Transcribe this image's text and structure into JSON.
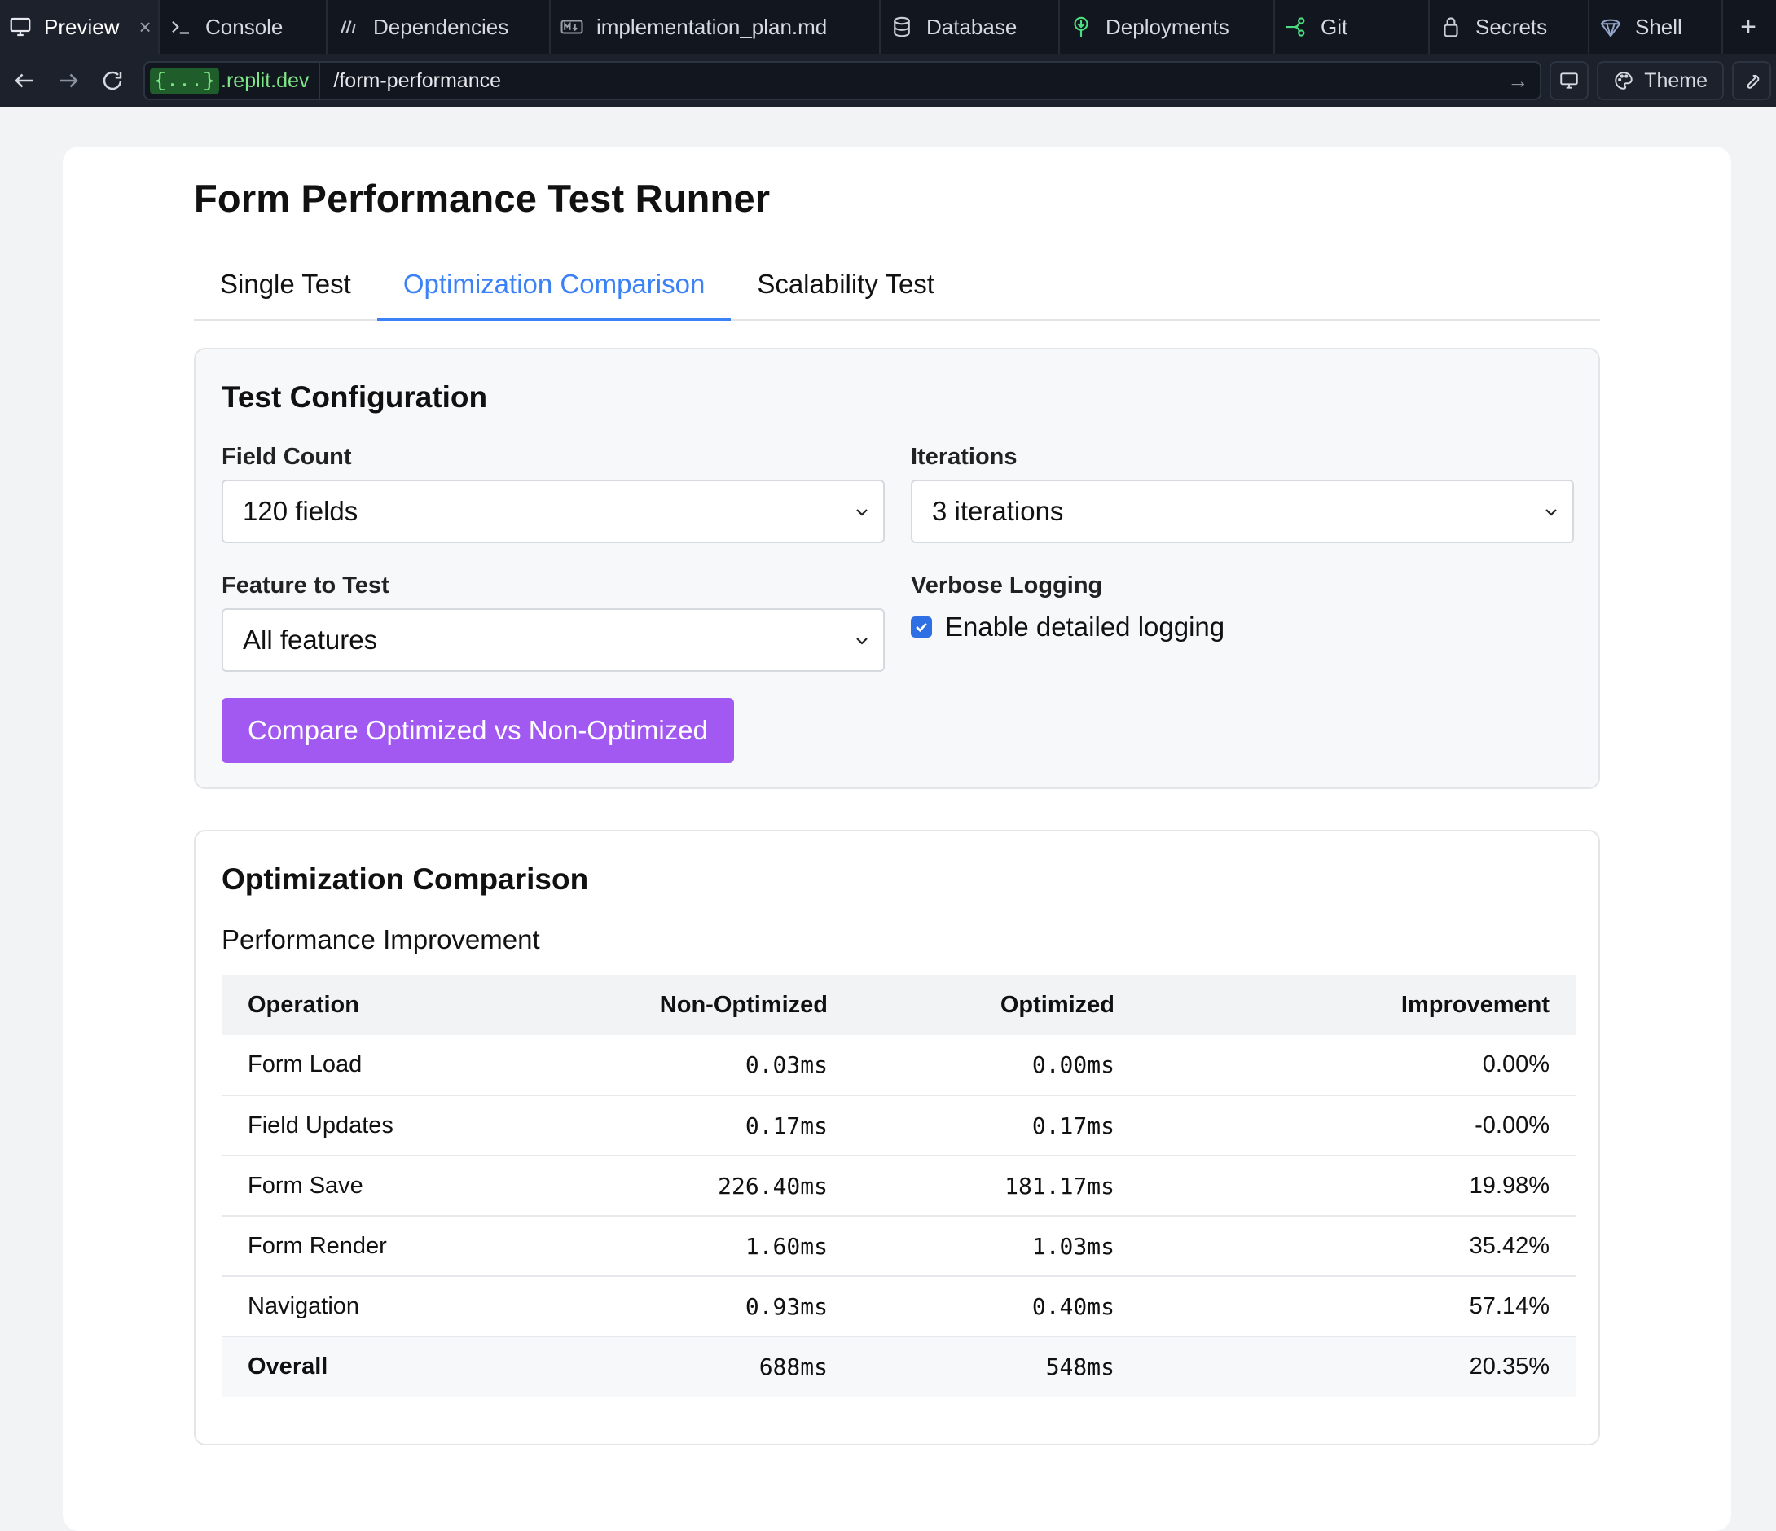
{
  "ide_tabs": [
    {
      "label": "Preview",
      "icon": "monitor-icon",
      "active": true,
      "closable": true
    },
    {
      "label": "Console",
      "icon": "terminal-icon"
    },
    {
      "label": "Dependencies",
      "icon": "dependencies-icon"
    },
    {
      "label": "implementation_plan.md",
      "icon": "markdown-icon"
    },
    {
      "label": "Database",
      "icon": "database-icon"
    },
    {
      "label": "Deployments",
      "icon": "deployments-icon"
    },
    {
      "label": "Git",
      "icon": "git-icon"
    },
    {
      "label": "Secrets",
      "icon": "lock-icon"
    },
    {
      "label": "Shell",
      "icon": "shell-icon"
    }
  ],
  "urlbar": {
    "domain_badge": "{...}",
    "domain_host": ".replit.dev",
    "path": "/form-performance",
    "theme_label": "Theme"
  },
  "page": {
    "title": "Form Performance Test Runner",
    "tabs": [
      "Single Test",
      "Optimization Comparison",
      "Scalability Test"
    ],
    "active_tab": "Optimization Comparison"
  },
  "config": {
    "heading": "Test Configuration",
    "field_count_label": "Field Count",
    "field_count_value": "120 fields",
    "iterations_label": "Iterations",
    "iterations_value": "3 iterations",
    "feature_label": "Feature to Test",
    "feature_value": "All features",
    "verbose_label": "Verbose Logging",
    "verbose_checkbox_label": "Enable detailed logging",
    "verbose_checked": true,
    "compare_button": "Compare Optimized vs Non-Optimized"
  },
  "results": {
    "heading": "Optimization Comparison",
    "subheading": "Performance Improvement",
    "columns": [
      "Operation",
      "Non-Optimized",
      "Optimized",
      "Improvement"
    ],
    "rows": [
      [
        "Form Load",
        "0.03ms",
        "0.00ms",
        "0.00%"
      ],
      [
        "Field Updates",
        "0.17ms",
        "0.17ms",
        "-0.00%"
      ],
      [
        "Form Save",
        "226.40ms",
        "181.17ms",
        "19.98%"
      ],
      [
        "Form Render",
        "1.60ms",
        "1.03ms",
        "35.42%"
      ],
      [
        "Navigation",
        "0.93ms",
        "0.40ms",
        "57.14%"
      ]
    ],
    "overall": [
      "Overall",
      "688ms",
      "548ms",
      "20.35%"
    ]
  },
  "colors": {
    "accent_blue": "#3b82f6",
    "button_purple": "#a259f2",
    "ide_bg": "#12161f",
    "domain_green": "#7ee787"
  }
}
